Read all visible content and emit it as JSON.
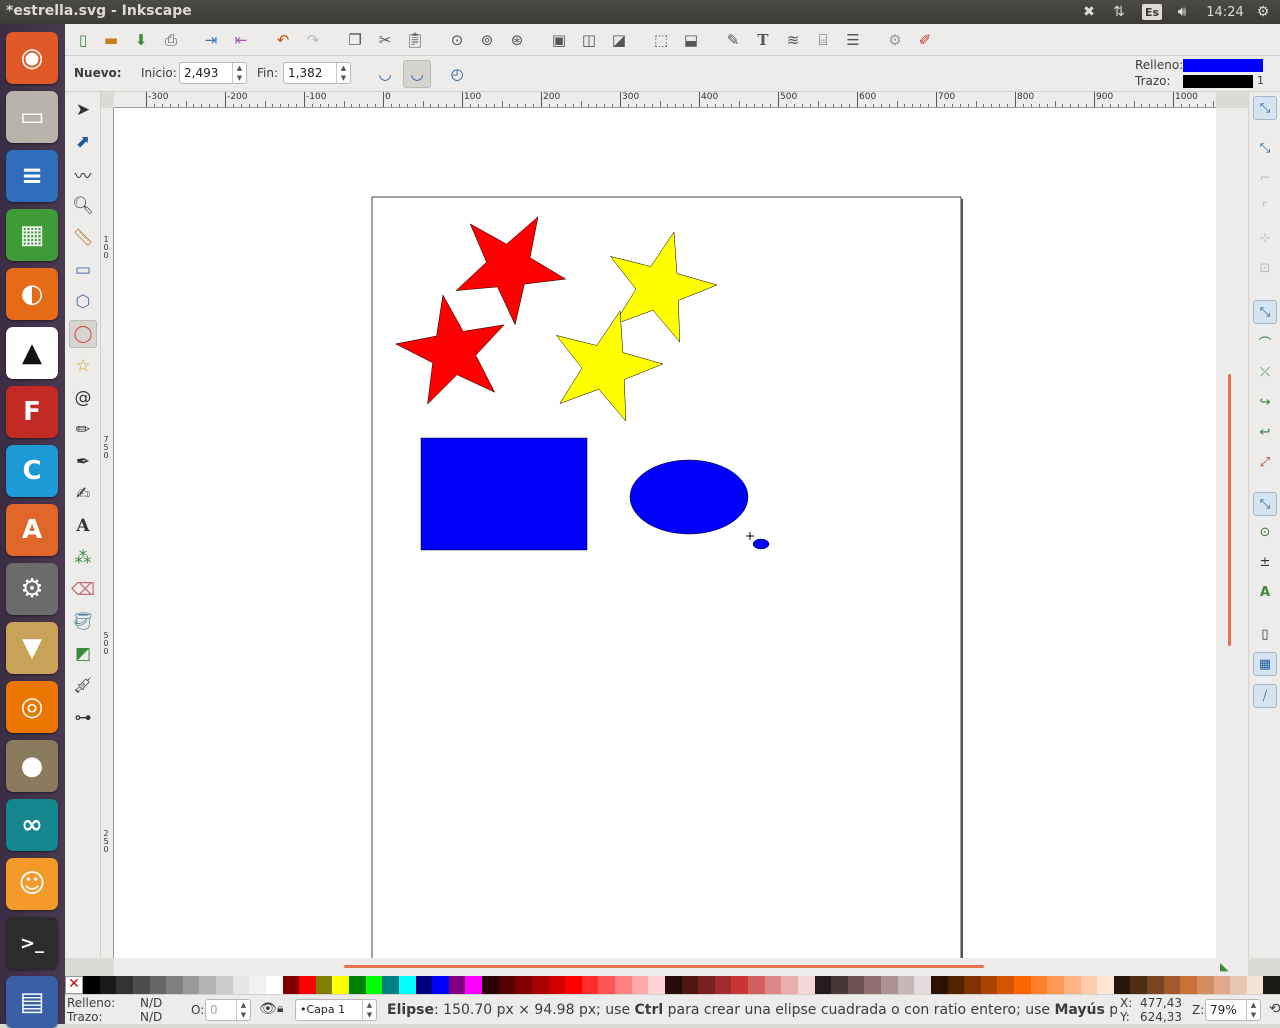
{
  "topbar": {
    "title": "*estrella.svg - Inkscape",
    "lang": "Es",
    "clock": "14:24"
  },
  "launcher": [
    {
      "name": "ubuntu-dash-icon",
      "bg": "#e05a28",
      "glyph": "◉"
    },
    {
      "name": "files-icon",
      "bg": "#b9b4aa",
      "glyph": "▭"
    },
    {
      "name": "writer-icon",
      "bg": "#2f6dbb",
      "glyph": "≡"
    },
    {
      "name": "calc-icon",
      "bg": "#3f9a38",
      "glyph": "▦"
    },
    {
      "name": "firefox-icon",
      "bg": "#e66b19",
      "glyph": "◐"
    },
    {
      "name": "inkscape-icon",
      "bg": "#ffffff",
      "glyph": "▲"
    },
    {
      "name": "fontforge-icon",
      "bg": "#c32a23",
      "glyph": "F"
    },
    {
      "name": "cmaptools-icon",
      "bg": "#1d9ad6",
      "glyph": "C"
    },
    {
      "name": "software-center-icon",
      "bg": "#e0662a",
      "glyph": "A"
    },
    {
      "name": "system-settings-icon",
      "bg": "#6b6b6b",
      "glyph": "⚙"
    },
    {
      "name": "archive-manager-icon",
      "bg": "#c9a25a",
      "glyph": "▼"
    },
    {
      "name": "blender-icon",
      "bg": "#ea7600",
      "glyph": "◎"
    },
    {
      "name": "gimp-icon",
      "bg": "#8a7b5e",
      "glyph": "●"
    },
    {
      "name": "arduino-icon",
      "bg": "#15868e",
      "glyph": "∞"
    },
    {
      "name": "scratch-icon",
      "bg": "#f39a2b",
      "glyph": "☺"
    },
    {
      "name": "terminal-icon",
      "bg": "#2c2c2c",
      "glyph": ">_"
    },
    {
      "name": "workspaces-icon",
      "bg": "#3a5fa8",
      "glyph": "▤"
    }
  ],
  "ctrl": {
    "new_label": "Nuevo:",
    "start_label": "Inicio:",
    "start_value": "2,493",
    "end_label": "Fin:",
    "end_value": "1,382"
  },
  "style_indicator": {
    "fill_label": "Relleno:",
    "stroke_label": "Trazo:",
    "fill_color": "#0000ff",
    "stroke_color": "#000000",
    "stroke_width": "1"
  },
  "ruler": {
    "h_labels": [
      "-300",
      "-200",
      "-100",
      "0",
      "100",
      "200",
      "300",
      "400",
      "500",
      "600",
      "700",
      "800",
      "900",
      "1000"
    ],
    "v_labels": [
      "100",
      "750",
      "500",
      "250"
    ]
  },
  "colors": {
    "star_red": "#ff0000",
    "star_yellow": "#ffff00",
    "shape_blue": "#0000ff"
  },
  "palette": [
    "#000000",
    "#1a1a1a",
    "#333333",
    "#4d4d4d",
    "#666666",
    "#808080",
    "#999999",
    "#b3b3b3",
    "#cccccc",
    "#e6e6e6",
    "#f2f2f2",
    "#ffffff",
    "#800000",
    "#ff0000",
    "#808000",
    "#ffff00",
    "#008000",
    "#00ff00",
    "#008080",
    "#00ffff",
    "#000080",
    "#0000ff",
    "#800080",
    "#ff00ff",
    "#2b0000",
    "#550000",
    "#800000",
    "#aa0000",
    "#d40000",
    "#ff0000",
    "#ff2a2a",
    "#ff5555",
    "#ff8080",
    "#ffaaaa",
    "#ffd5d5",
    "#280b0b",
    "#501616",
    "#782121",
    "#a02c2c",
    "#c83737",
    "#d35f5f",
    "#de8787",
    "#e9afaf",
    "#f4d7d7",
    "#241c1c",
    "#483737",
    "#6c5353",
    "#916f6f",
    "#ac9393",
    "#c8b7b7",
    "#e3dbdb",
    "#2b1100",
    "#552200",
    "#803300",
    "#aa4400",
    "#d45500",
    "#ff6600",
    "#ff7f2a",
    "#ff9955",
    "#ffb380",
    "#ffccaa",
    "#ffe6d5",
    "#28170b",
    "#502d16",
    "#784421",
    "#a05a2c",
    "#c87137",
    "#d38d5f",
    "#deaa87",
    "#e9c6af",
    "#f4e3d7",
    "#1c1a17"
  ],
  "status": {
    "fill_label": "Relleno:",
    "fill_value": "N/D",
    "stroke_label": "Trazo:",
    "stroke_value": "N/D",
    "opacity_label": "O:",
    "opacity_value": "0",
    "layer": "•Capa 1",
    "message_tool": "Elipse",
    "message_a": ": 150.70 px × 94.98 px; use ",
    "message_ctrl": "Ctrl",
    "message_b": " para crear una elipse cuadrada o con ratio entero; use ",
    "message_shift": "Mayús",
    "message_c": " para traz.",
    "x_label": "X:",
    "x_value": "477,43",
    "y_label": "Y:",
    "y_value": "624,33",
    "zoom_label": "Z:",
    "zoom_value": "79%"
  }
}
